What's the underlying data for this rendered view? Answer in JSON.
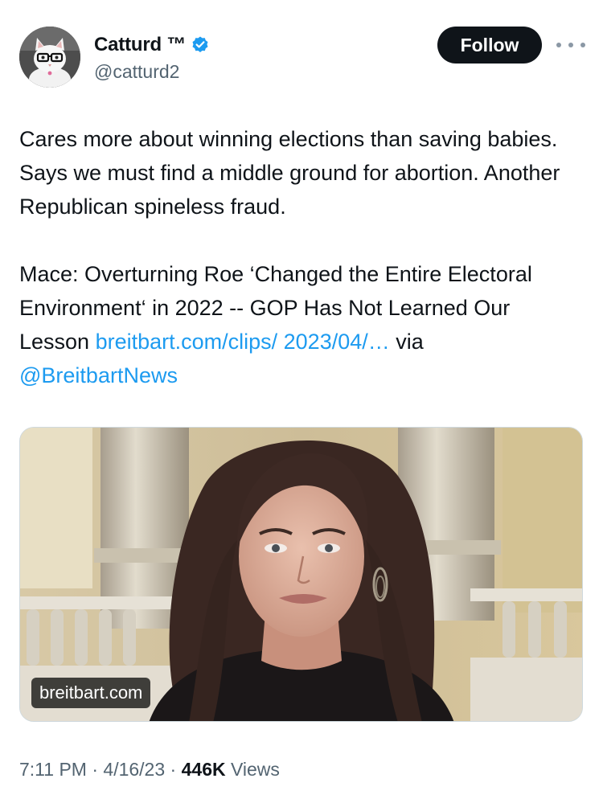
{
  "author": {
    "display_name": "Catturd ™",
    "handle": "@catturd2",
    "verified": true,
    "avatar_icon": "cat-with-glasses-avatar"
  },
  "actions": {
    "follow_label": "Follow",
    "more_icon": "more-horizontal-icon"
  },
  "tweet": {
    "paragraph1": "Cares more about winning elections than saving babies. Says we must find a middle ground for abortion. Another Republican spineless fraud.",
    "headline": "Mace: Overturning Roe ‘Changed the Entire Electoral Environment‘ in 2022 -- GOP Has Not Learned Our Lesson ",
    "link_text": "breitbart.com/clips/ 2023/04/…",
    "via_text": " via ",
    "mention": "@BreitbartNews"
  },
  "media": {
    "source_label": "breitbart.com"
  },
  "meta": {
    "time": "7:11 PM",
    "separator": " · ",
    "date": "4/16/23",
    "views_count": "446K",
    "views_label": " Views"
  },
  "colors": {
    "link": "#1d9bf0",
    "text": "#0f1419",
    "secondary": "#536471",
    "follow_bg": "#0f1419",
    "verified": "#1d9bf0"
  }
}
